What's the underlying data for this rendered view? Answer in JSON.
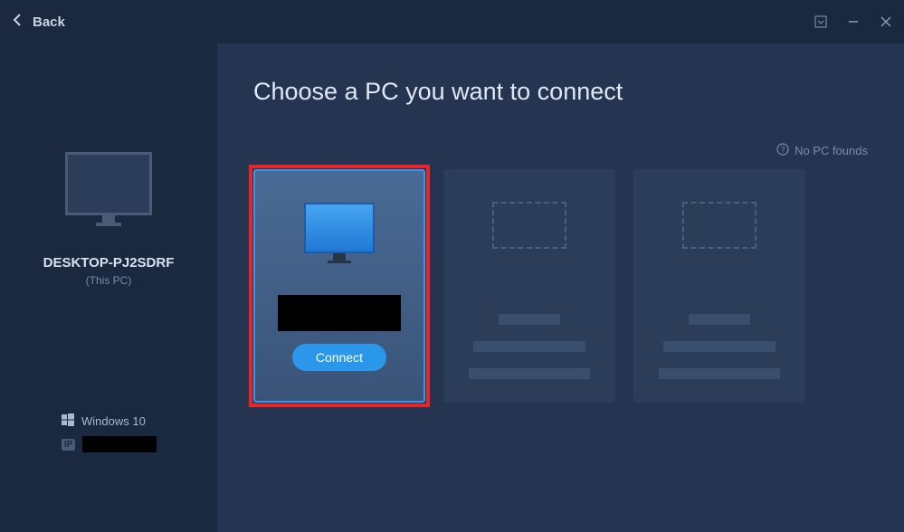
{
  "header": {
    "back_label": "Back"
  },
  "sidebar": {
    "pc_name": "DESKTOP-PJ2SDRF",
    "this_pc_label": "(This PC)",
    "os_label": "Windows 10",
    "ip_badge": "IP",
    "ip_value": ""
  },
  "main": {
    "title": "Choose a PC you want to connect",
    "no_pc_link": "No PC founds",
    "connect_button": "Connect",
    "active_pc_name": ""
  }
}
